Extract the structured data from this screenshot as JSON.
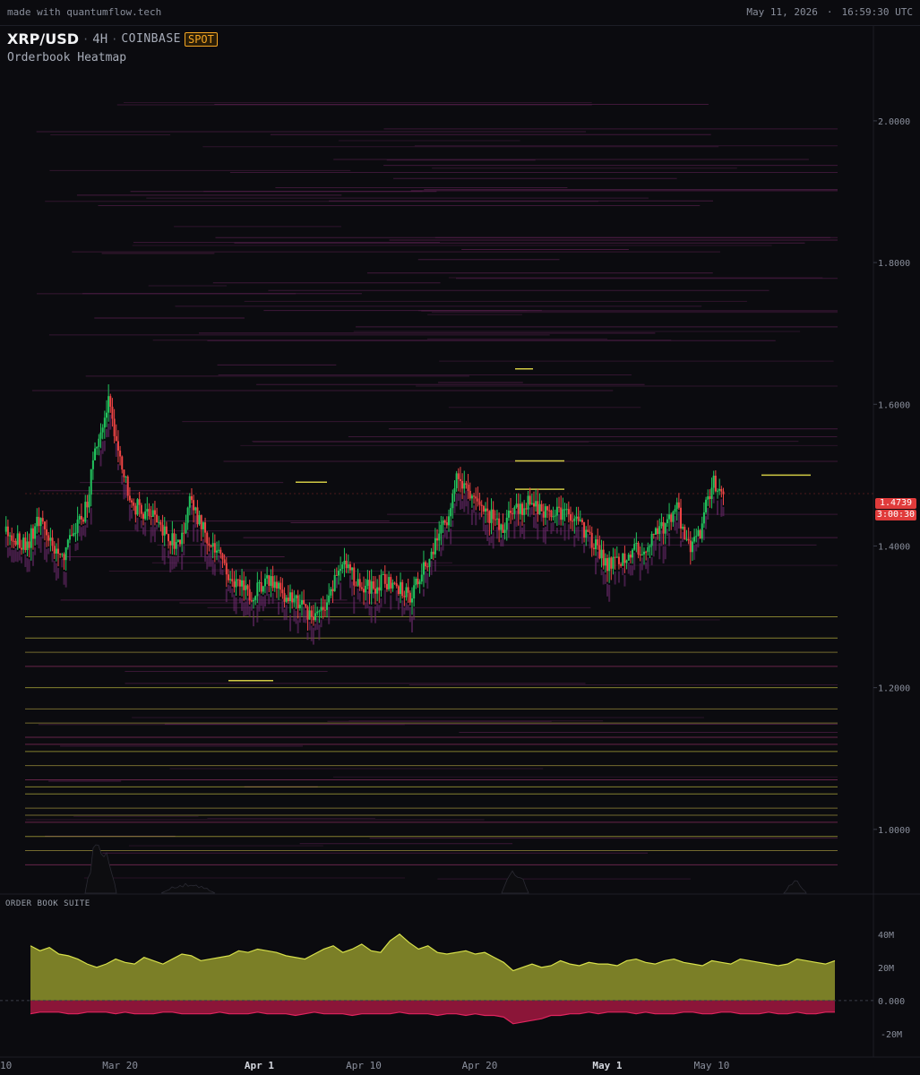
{
  "topbar": {
    "brand": "made with quantumflow.tech",
    "date": "May 11, 2026",
    "time": "16:59:30 UTC"
  },
  "header": {
    "pair": "XRP/USD",
    "timeframe": "4H",
    "exchange": "COINBASE",
    "market": "SPOT",
    "subtitle": "Orderbook Heatmap"
  },
  "price_tag": {
    "price": "1.4739",
    "countdown": "3:00:30"
  },
  "bottom_panel": {
    "label": "ORDER BOOK SUITE"
  },
  "colors": {
    "background": "#0b0b0f",
    "up": "#22c55e",
    "down": "#ef4444",
    "bid_area": "#7b7f27",
    "bid_line": "#d7e04a",
    "ask_area": "#8b1538",
    "ask_line": "#e0245e",
    "level_yellow": "#e8e04a",
    "level_purple": "#5a2050",
    "current_price": "#e03b3b"
  },
  "chart_data": [
    {
      "type": "candlestick-heatmap",
      "yticks": [
        "2.0000",
        "1.8000",
        "1.6000",
        "1.4000",
        "1.2000",
        "1.0000"
      ],
      "ylim": [
        0.91,
        2.12
      ],
      "xticks": [
        "10",
        "Mar 20",
        "Apr 1",
        "Apr 10",
        "Apr 20",
        "May 1",
        "May 10"
      ],
      "last_price": 1.4739,
      "price_path": [
        [
          "Mar 10",
          1.42
        ],
        [
          "Mar 12",
          1.4
        ],
        [
          "Mar 13",
          1.44
        ],
        [
          "Mar 15",
          1.38
        ],
        [
          "Mar 17",
          1.45
        ],
        [
          "Mar 18",
          1.55
        ],
        [
          "Mar 19",
          1.6
        ],
        [
          "Mar 20",
          1.52
        ],
        [
          "Mar 21",
          1.46
        ],
        [
          "Mar 23",
          1.44
        ],
        [
          "Mar 25",
          1.4
        ],
        [
          "Mar 26",
          1.46
        ],
        [
          "Mar 28",
          1.4
        ],
        [
          "Mar 29",
          1.37
        ],
        [
          "Mar 31",
          1.33
        ],
        [
          "Apr 2",
          1.35
        ],
        [
          "Apr 4",
          1.32
        ],
        [
          "Apr 6",
          1.3
        ],
        [
          "Apr 7",
          1.32
        ],
        [
          "Apr 8",
          1.38
        ],
        [
          "Apr 10",
          1.34
        ],
        [
          "Apr 12",
          1.35
        ],
        [
          "Apr 14",
          1.33
        ],
        [
          "Apr 15",
          1.36
        ],
        [
          "Apr 17",
          1.43
        ],
        [
          "Apr 18",
          1.5
        ],
        [
          "Apr 20",
          1.45
        ],
        [
          "Apr 22",
          1.43
        ],
        [
          "Apr 24",
          1.46
        ],
        [
          "Apr 26",
          1.45
        ],
        [
          "Apr 28",
          1.44
        ],
        [
          "Apr 30",
          1.4
        ],
        [
          "May 1",
          1.37
        ],
        [
          "May 3",
          1.39
        ],
        [
          "May 5",
          1.41
        ],
        [
          "May 7",
          1.45
        ],
        [
          "May 8",
          1.4
        ],
        [
          "May 9",
          1.42
        ],
        [
          "May 10",
          1.49
        ],
        [
          "May 11",
          1.4739
        ]
      ]
    },
    {
      "type": "area",
      "title": "ORDER BOOK SUITE",
      "yticks": [
        "40M",
        "20M",
        "0.000",
        "-20M"
      ],
      "ylim": [
        -26,
        48
      ],
      "series": [
        {
          "values": [
            33,
            30,
            32,
            28,
            27,
            25,
            22,
            20,
            22,
            25,
            23,
            22,
            26,
            24,
            22,
            25,
            28,
            27,
            24,
            25,
            26,
            27,
            30,
            29,
            31,
            30,
            29,
            27,
            26,
            25,
            28,
            31,
            33,
            29,
            31,
            34,
            30,
            29,
            36,
            40,
            35,
            31,
            33,
            29,
            28,
            29,
            30,
            28,
            29,
            26,
            23,
            18,
            20,
            22,
            20,
            21,
            24,
            22,
            21,
            23,
            22,
            22,
            21,
            24,
            25,
            23,
            22,
            24,
            25,
            23,
            22,
            21,
            24,
            23,
            22,
            25,
            24,
            23,
            22,
            21,
            22,
            25,
            24,
            23,
            22,
            24
          ]
        },
        {
          "values": [
            -8,
            -7,
            -7,
            -7,
            -8,
            -8,
            -7,
            -7,
            -7,
            -8,
            -7,
            -8,
            -8,
            -8,
            -7,
            -7,
            -8,
            -8,
            -8,
            -8,
            -7,
            -8,
            -8,
            -8,
            -7,
            -8,
            -8,
            -8,
            -9,
            -8,
            -7,
            -8,
            -8,
            -8,
            -9,
            -8,
            -8,
            -8,
            -8,
            -7,
            -8,
            -8,
            -8,
            -9,
            -8,
            -8,
            -9,
            -8,
            -9,
            -9,
            -10,
            -14,
            -13,
            -12,
            -11,
            -9,
            -9,
            -8,
            -8,
            -7,
            -8,
            -7,
            -7,
            -7,
            -8,
            -7,
            -8,
            -8,
            -8,
            -7,
            -7,
            -8,
            -8,
            -7,
            -7,
            -8,
            -8,
            -8,
            -7,
            -8,
            -8,
            -7,
            -8,
            -8,
            -7,
            -7
          ]
        }
      ]
    }
  ]
}
